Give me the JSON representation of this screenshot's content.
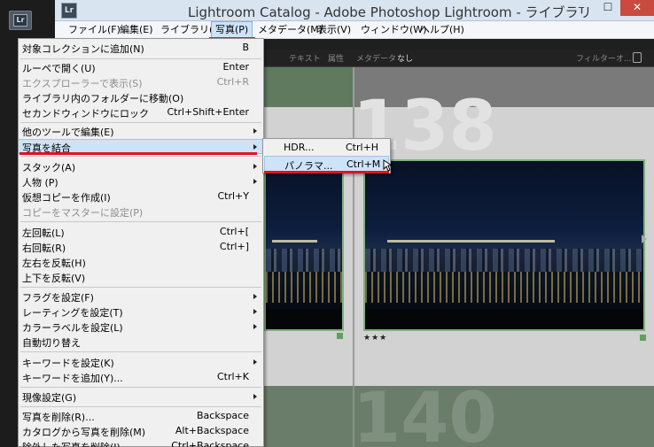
{
  "window": {
    "title": "Lightroom Catalog - Adobe Photoshop Lightroom - ライブラリ",
    "app_icon": "Lr",
    "minimize": "‒",
    "maximize": "☐",
    "close": "✕"
  },
  "taskbar": {
    "icon": "Lr"
  },
  "menubar": {
    "items": [
      "ファイル(F)",
      "編集(E)",
      "ライブラリ(L)",
      "写真(P)",
      "メタデータ(M)",
      "表示(V)",
      "ウィンドウ(W)",
      "ヘルプ(H)"
    ],
    "active_index": 3
  },
  "toolbar": {
    "labels": [
      "テキスト",
      "属性",
      "メタデータ",
      "なし"
    ],
    "filter": "フィルターオ..."
  },
  "grid": {
    "cell_numbers": [
      "138",
      "140"
    ],
    "rating": "★★★"
  },
  "photo_menu": {
    "items": [
      {
        "label": "対象コレクションに追加(N)",
        "shortcut": "B",
        "disabled": false,
        "submenu": false
      },
      {
        "label": "ルーペで開く(U)",
        "shortcut": "Enter",
        "disabled": false,
        "submenu": false
      },
      {
        "label": "エクスプローラーで表示(S)",
        "shortcut": "Ctrl+R",
        "disabled": true,
        "submenu": false
      },
      {
        "label": "ライブラリ内のフォルダーに移動(O)",
        "shortcut": "",
        "disabled": false,
        "submenu": false
      },
      {
        "label": "セカンドウィンドウにロック",
        "shortcut": "Ctrl+Shift+Enter",
        "disabled": false,
        "submenu": false
      },
      {
        "label": "他のツールで編集(E)",
        "shortcut": "",
        "disabled": false,
        "submenu": true
      },
      {
        "label": "写真を結合",
        "shortcut": "",
        "disabled": false,
        "submenu": true
      },
      {
        "label": "スタック(A)",
        "shortcut": "",
        "disabled": false,
        "submenu": true
      },
      {
        "label": "人物 (P)",
        "shortcut": "",
        "disabled": false,
        "submenu": true
      },
      {
        "label": "仮想コピーを作成(I)",
        "shortcut": "Ctrl+Y",
        "disabled": false,
        "submenu": false
      },
      {
        "label": "コピーをマスターに設定(P)",
        "shortcut": "",
        "disabled": true,
        "submenu": false
      },
      {
        "label": "左回転(L)",
        "shortcut": "Ctrl+[",
        "disabled": false,
        "submenu": false
      },
      {
        "label": "右回転(R)",
        "shortcut": "Ctrl+]",
        "disabled": false,
        "submenu": false
      },
      {
        "label": "左右を反転(H)",
        "shortcut": "",
        "disabled": false,
        "submenu": false
      },
      {
        "label": "上下を反転(V)",
        "shortcut": "",
        "disabled": false,
        "submenu": false
      },
      {
        "label": "フラグを設定(F)",
        "shortcut": "",
        "disabled": false,
        "submenu": true
      },
      {
        "label": "レーティングを設定(T)",
        "shortcut": "",
        "disabled": false,
        "submenu": true
      },
      {
        "label": "カラーラベルを設定(L)",
        "shortcut": "",
        "disabled": false,
        "submenu": true
      },
      {
        "label": "自動切り替え",
        "shortcut": "",
        "disabled": false,
        "submenu": false
      },
      {
        "label": "キーワードを設定(K)",
        "shortcut": "",
        "disabled": false,
        "submenu": true
      },
      {
        "label": "キーワードを追加(Y)...",
        "shortcut": "Ctrl+K",
        "disabled": false,
        "submenu": false
      },
      {
        "label": "現像設定(G)",
        "shortcut": "",
        "disabled": false,
        "submenu": true
      },
      {
        "label": "写真を削除(R)...",
        "shortcut": "Backspace",
        "disabled": false,
        "submenu": false
      },
      {
        "label": "カタログから写真を削除(M)",
        "shortcut": "Alt+Backspace",
        "disabled": false,
        "submenu": false
      },
      {
        "label": "除外した写真を削除(J)...",
        "shortcut": "Ctrl+Backspace",
        "disabled": false,
        "submenu": false
      }
    ],
    "selected_index": 6
  },
  "merge_submenu": {
    "items": [
      {
        "label": "HDR...",
        "shortcut": "Ctrl+H"
      },
      {
        "label": "パノラマ...",
        "shortcut": "Ctrl+M"
      }
    ],
    "selected_index": 1
  },
  "colors": {
    "annotation": "#e0141e",
    "selection": "#cde3f8",
    "titlebar": "#d9e4f1"
  }
}
